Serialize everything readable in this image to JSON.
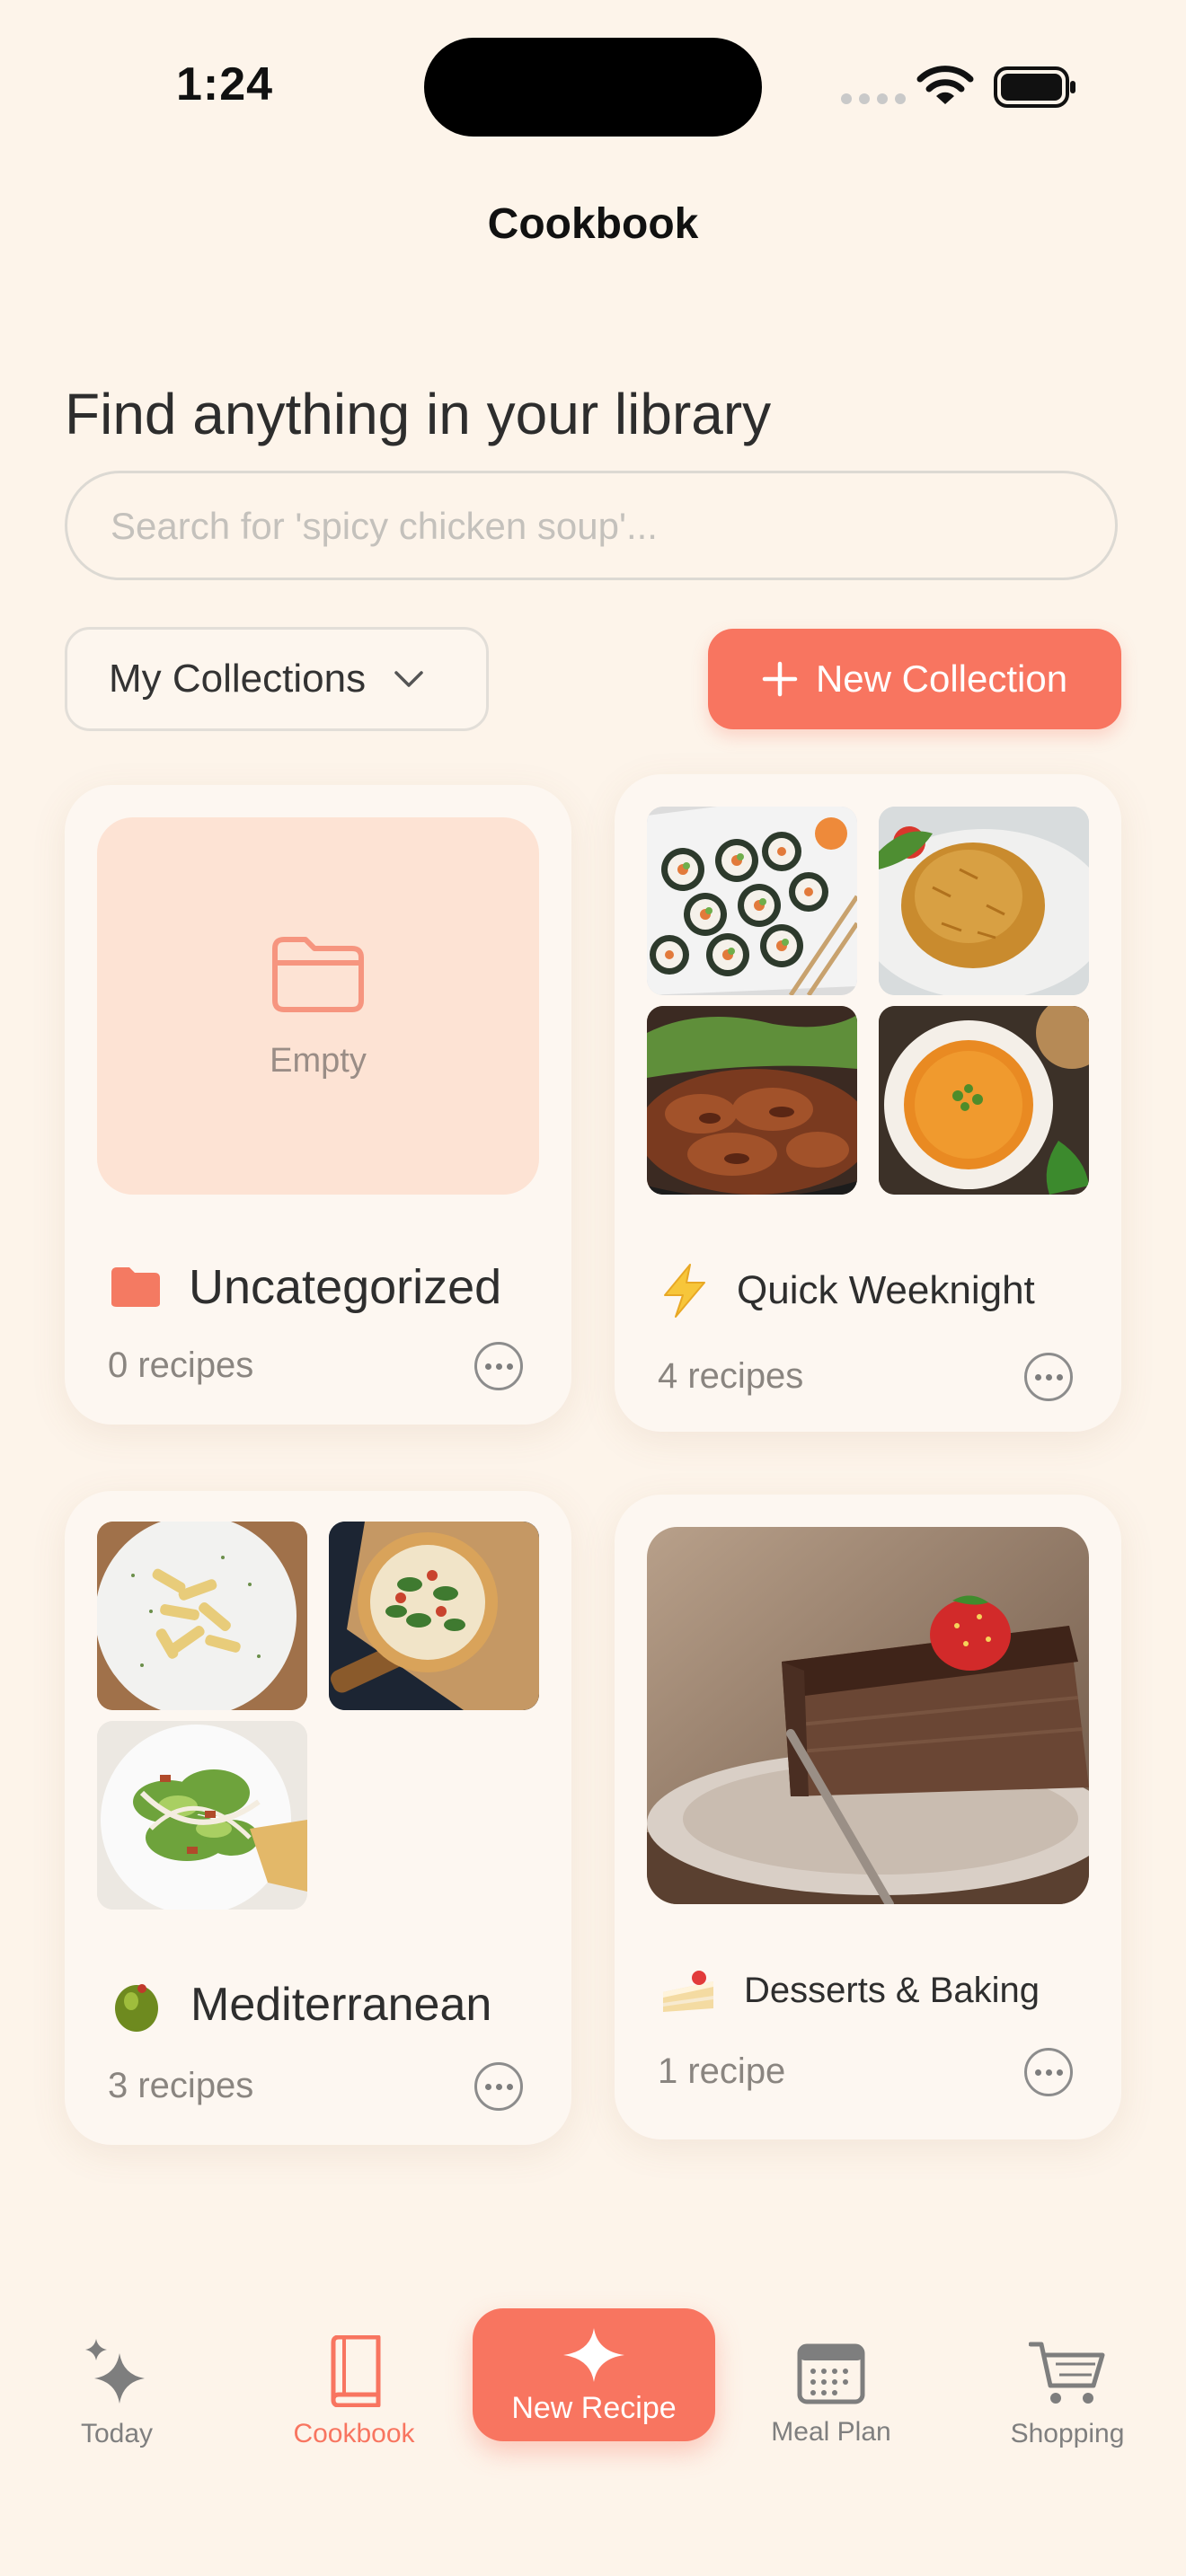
{
  "status": {
    "time": "1:24"
  },
  "nav": {
    "title": "Cookbook"
  },
  "library": {
    "heading": "Find anything in your library",
    "search_placeholder": "Search for 'spicy chicken soup'..."
  },
  "toolbar": {
    "collections_label": "My Collections",
    "new_collection_label": "New Collection"
  },
  "collections": [
    {
      "name": "Uncategorized",
      "count": "0 recipes",
      "icon": "folder-icon",
      "empty_label": "Empty"
    },
    {
      "name": "Quick Weeknight",
      "count": "4 recipes",
      "icon": "lightning-icon"
    },
    {
      "name": "Mediterranean",
      "count": "3 recipes",
      "icon": "olive-icon"
    },
    {
      "name": "Desserts & Baking",
      "count": "1 recipe",
      "icon": "cake-icon"
    }
  ],
  "tabs": [
    {
      "label": "Today",
      "icon": "sparkles-icon"
    },
    {
      "label": "Cookbook",
      "icon": "book-icon",
      "active": true
    },
    {
      "label": "New Recipe",
      "icon": "star-icon"
    },
    {
      "label": "Meal Plan",
      "icon": "calendar-icon"
    },
    {
      "label": "Shopping",
      "icon": "cart-icon"
    }
  ],
  "colors": {
    "accent": "#f87560",
    "background": "#fdf4ea",
    "card": "#fdf7f1",
    "empty_tile": "#fde3d4"
  }
}
